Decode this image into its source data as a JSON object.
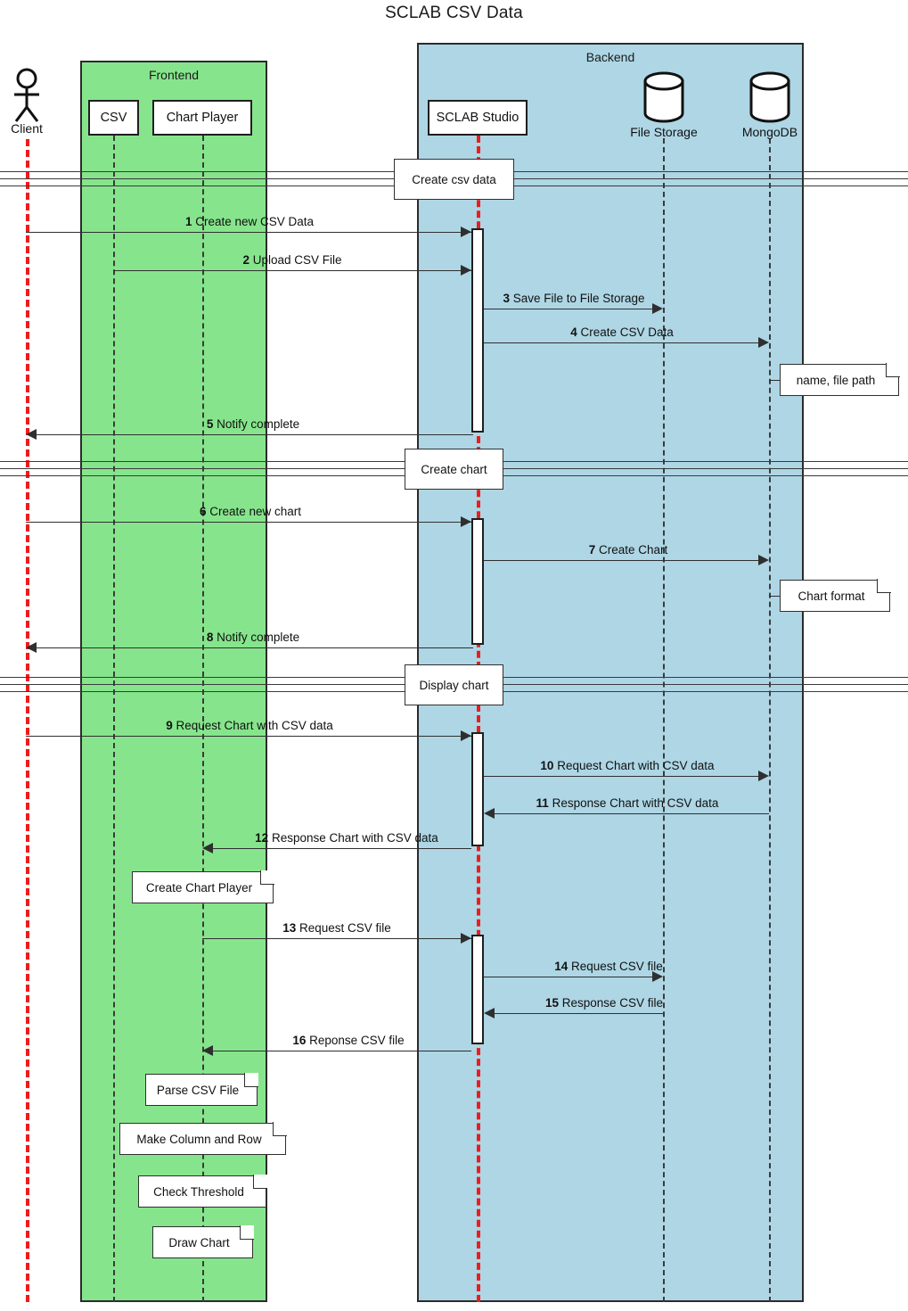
{
  "diagram": {
    "title": "SCLAB CSV Data",
    "type": "uml-sequence-diagram"
  },
  "groups": [
    {
      "id": "frontend",
      "label": "Frontend",
      "color": "#86e58c"
    },
    {
      "id": "backend",
      "label": "Backend",
      "color": "#aed6e5"
    }
  ],
  "participants": [
    {
      "id": "client",
      "label": "Client",
      "kind": "actor",
      "lifeline_color": "#ee1c1c"
    },
    {
      "id": "csv",
      "label": "CSV",
      "kind": "object",
      "group": "frontend",
      "lifeline_color": "#3a3a3a"
    },
    {
      "id": "chart_player",
      "label": "Chart Player",
      "kind": "object",
      "group": "frontend",
      "lifeline_color": "#3a3a3a"
    },
    {
      "id": "sclab_studio",
      "label": "SCLAB Studio",
      "kind": "object",
      "group": "backend",
      "lifeline_color": "#ee1c1c"
    },
    {
      "id": "file_storage",
      "label": "File Storage",
      "kind": "database",
      "group": "backend",
      "lifeline_color": "#3a3a3a"
    },
    {
      "id": "mongodb",
      "label": "MongoDB",
      "kind": "database",
      "group": "backend",
      "lifeline_color": "#3a3a3a"
    }
  ],
  "fragments": [
    {
      "id": "frag1",
      "label": "Create csv data"
    },
    {
      "id": "frag2",
      "label": "Create chart"
    },
    {
      "id": "frag3",
      "label": "Display chart"
    }
  ],
  "messages": [
    {
      "num": "1",
      "text": "Create new CSV Data",
      "from": "client",
      "to": "sclab_studio",
      "dir": "right"
    },
    {
      "num": "2",
      "text": "Upload CSV File",
      "from": "csv",
      "to": "sclab_studio",
      "dir": "right"
    },
    {
      "num": "3",
      "text": "Save File to File Storage",
      "from": "sclab_studio",
      "to": "file_storage",
      "dir": "right"
    },
    {
      "num": "4",
      "text": "Create CSV Data",
      "from": "sclab_studio",
      "to": "mongodb",
      "dir": "right"
    },
    {
      "num": "5",
      "text": "Notify complete",
      "from": "sclab_studio",
      "to": "client",
      "dir": "left"
    },
    {
      "num": "6",
      "text": "Create new chart",
      "from": "client",
      "to": "sclab_studio",
      "dir": "right"
    },
    {
      "num": "7",
      "text": "Create Chart",
      "from": "sclab_studio",
      "to": "mongodb",
      "dir": "right"
    },
    {
      "num": "8",
      "text": "Notify complete",
      "from": "sclab_studio",
      "to": "client",
      "dir": "left"
    },
    {
      "num": "9",
      "text": "Request Chart with CSV data",
      "from": "client",
      "to": "sclab_studio",
      "dir": "right"
    },
    {
      "num": "10",
      "text": "Request Chart with CSV data",
      "from": "sclab_studio",
      "to": "mongodb",
      "dir": "right"
    },
    {
      "num": "11",
      "text": "Response Chart with CSV data",
      "from": "mongodb",
      "to": "sclab_studio",
      "dir": "left"
    },
    {
      "num": "12",
      "text": "Response Chart with CSV data",
      "from": "sclab_studio",
      "to": "chart_player",
      "dir": "left"
    },
    {
      "num": "13",
      "text": "Request CSV file",
      "from": "chart_player",
      "to": "sclab_studio",
      "dir": "right"
    },
    {
      "num": "14",
      "text": "Request CSV file",
      "from": "sclab_studio",
      "to": "file_storage",
      "dir": "right"
    },
    {
      "num": "15",
      "text": "Response CSV file",
      "from": "file_storage",
      "to": "sclab_studio",
      "dir": "left"
    },
    {
      "num": "16",
      "text": "Reponse CSV file",
      "from": "sclab_studio",
      "to": "chart_player",
      "dir": "left"
    }
  ],
  "notes": [
    {
      "id": "note_name_filepath",
      "text": "name, file path",
      "attached_to": "mongodb"
    },
    {
      "id": "note_chart_format",
      "text": "Chart format",
      "attached_to": "mongodb"
    },
    {
      "id": "note_create_player",
      "text": "Create Chart Player",
      "attached_to": "chart_player"
    },
    {
      "id": "note_parse_csv",
      "text": "Parse CSV File",
      "attached_to": "chart_player"
    },
    {
      "id": "note_make_col_row",
      "text": "Make Column and Row",
      "attached_to": "chart_player"
    },
    {
      "id": "note_check_threshold",
      "text": "Check Threshold",
      "attached_to": "chart_player"
    },
    {
      "id": "note_draw_chart",
      "text": "Draw Chart",
      "attached_to": "chart_player"
    }
  ]
}
